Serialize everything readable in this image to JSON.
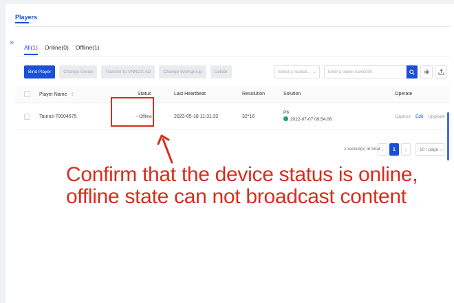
{
  "page": {
    "title": "Players",
    "collapse_glyph": "»"
  },
  "tabs": [
    {
      "label": "All(1)",
      "active": true
    },
    {
      "label": "Online(0)",
      "active": false
    },
    {
      "label": "Offline(1)",
      "active": false
    }
  ],
  "toolbar": {
    "bind_player": "Bind Player",
    "change_group": "Change Group",
    "transfer": "Transfer to VNNOX AD",
    "change_workgroup": "Change Workgroup",
    "delete": "Delete",
    "resolution_placeholder": "Select a resoluti...",
    "search_placeholder": "Enter a player name/SN"
  },
  "table": {
    "headers": {
      "name": "Player Name",
      "status": "Status",
      "heartbeat": "Last Heartbeat",
      "resolution": "Resolution",
      "solution": "Solution",
      "operate": "Operate"
    },
    "rows": [
      {
        "name": "Taurus-70004675",
        "status": "Offline",
        "heartbeat": "2023-05-18 11:31:32",
        "resolution": "32*16",
        "solution_name": "P6",
        "solution_time": "2022-07-07 09:54:06",
        "ops": {
          "capture": "Capture",
          "edit": "Edit",
          "upgrade": "Upgrade"
        }
      }
    ]
  },
  "pagination": {
    "total_text": "1 record(s) in total",
    "current_page": "1",
    "page_size": "10 / page"
  },
  "annotation": {
    "text": "Confirm that the device status is online, offline state can not broadcast content",
    "color": "#d62d1e"
  },
  "colors": {
    "accent": "#1a4fd6",
    "online_dot": "#21a366",
    "annotation": "#d62d1e"
  }
}
